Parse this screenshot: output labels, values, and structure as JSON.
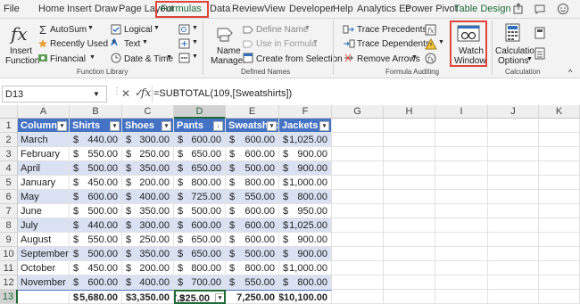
{
  "tabs": [
    "File",
    "Home",
    "Insert",
    "Draw",
    "Page Layout",
    "Formulas",
    "Data",
    "Review",
    "View",
    "Developer",
    "Help",
    "Analytics Ec",
    "Power Pivot",
    "Table Design"
  ],
  "ribbon": {
    "insert_function": [
      "Insert",
      "Function"
    ],
    "autosum": "AutoSum",
    "recently_used": "Recently Used",
    "financial": "Financial",
    "logical": "Logical",
    "text": "Text",
    "date_time": "Date & Time",
    "name_manager": [
      "Name",
      "Manager"
    ],
    "define_name": "Define Name",
    "use_in_formula": "Use in Formula",
    "create_from_selection": "Create from Selection",
    "trace_precedents": "Trace Precedents",
    "trace_dependents": "Trace Dependents",
    "remove_arrows": "Remove Arrows",
    "watch_window": [
      "Watch",
      "Window"
    ],
    "calc_options": [
      "Calculation",
      "Options"
    ],
    "groups": {
      "function_library": "Function Library",
      "defined_names": "Defined Names",
      "formula_auditing": "Formula Auditing",
      "calculation": "Calculation"
    }
  },
  "formula_bar": {
    "name_box": "D13",
    "fx": "fx",
    "formula": "=SUBTOTAL(109,[Sweatshirts])"
  },
  "columns": [
    "A",
    "B",
    "C",
    "D",
    "E",
    "F",
    "G",
    "H",
    "I",
    "J",
    "K"
  ],
  "rows": [
    "1",
    "2",
    "3",
    "4",
    "5",
    "6",
    "7",
    "8",
    "9",
    "10",
    "11",
    "12",
    "13"
  ],
  "table": {
    "headers": [
      "Column1",
      "Shirts",
      "Shoes",
      "Pants",
      "Sweatshirts",
      "Jackets"
    ],
    "data": [
      [
        "March",
        "440.00",
        "300.00",
        "600.00",
        "600.00",
        "1,025.00"
      ],
      [
        "February",
        "550.00",
        "250.00",
        "650.00",
        "600.00",
        "900.00"
      ],
      [
        "April",
        "500.00",
        "350.00",
        "650.00",
        "500.00",
        "900.00"
      ],
      [
        "January",
        "450.00",
        "200.00",
        "800.00",
        "800.00",
        "1,000.00"
      ],
      [
        "May",
        "600.00",
        "400.00",
        "725.00",
        "550.00",
        "800.00"
      ],
      [
        "June",
        "500.00",
        "350.00",
        "500.00",
        "600.00",
        "950.00"
      ],
      [
        "July",
        "440.00",
        "300.00",
        "600.00",
        "600.00",
        "1,025.00"
      ],
      [
        "August",
        "550.00",
        "250.00",
        "650.00",
        "600.00",
        "900.00"
      ],
      [
        "September",
        "500.00",
        "350.00",
        "650.00",
        "500.00",
        "900.00"
      ],
      [
        "October",
        "450.00",
        "200.00",
        "800.00",
        "800.00",
        "1,000.00"
      ],
      [
        "November",
        "600.00",
        "400.00",
        "700.00",
        "550.00",
        "800.00"
      ]
    ],
    "currency": "$",
    "totals": [
      "",
      "5,680.00",
      "3,350.00",
      "7,325.00",
      "7,250.00",
      "$10,100.00"
    ]
  },
  "colors": {
    "table_header": "#4472c4",
    "band": "#d9e1f2",
    "accent": "#1e6b35",
    "highlight": "#e0453a"
  }
}
